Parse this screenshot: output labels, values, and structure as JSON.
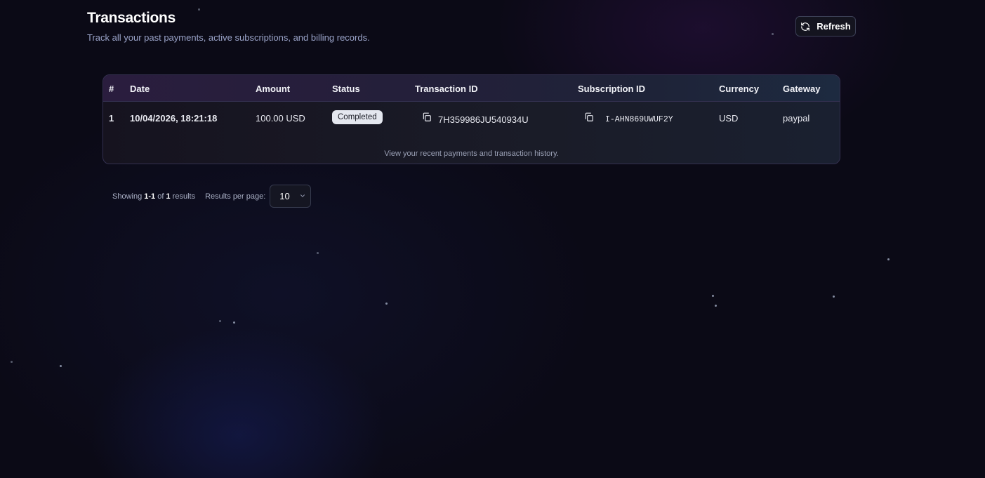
{
  "header": {
    "title": "Transactions",
    "subtitle": "Track all your past payments, active subscriptions, and billing records.",
    "refresh_label": "Refresh"
  },
  "table": {
    "columns": [
      "#",
      "Date",
      "Amount",
      "Status",
      "Transaction ID",
      "Subscription ID",
      "Currency",
      "Gateway"
    ],
    "rows": [
      {
        "index": "1",
        "date": "10/04/2026, 18:21:18",
        "amount": "100.00 USD",
        "status": "Completed",
        "transaction_id": "7H359986JU540934U",
        "subscription_id": "I-AHN869UWUF2Y",
        "currency": "USD",
        "gateway": "paypal"
      }
    ],
    "caption": "View your recent payments and transaction history."
  },
  "pagination": {
    "showing_prefix": "Showing",
    "range": "1-1",
    "of_word": "of",
    "total": "1",
    "results_word": "results",
    "per_page_label": "Results per page:",
    "per_page_value": "10"
  },
  "icons": {
    "refresh": "refresh-icon",
    "copy": "copy-icon",
    "chevron": "chevron-down-icon"
  },
  "colors": {
    "background": "#0b0a16",
    "badge_bg": "#e4e7ef",
    "border": "#33304f"
  }
}
